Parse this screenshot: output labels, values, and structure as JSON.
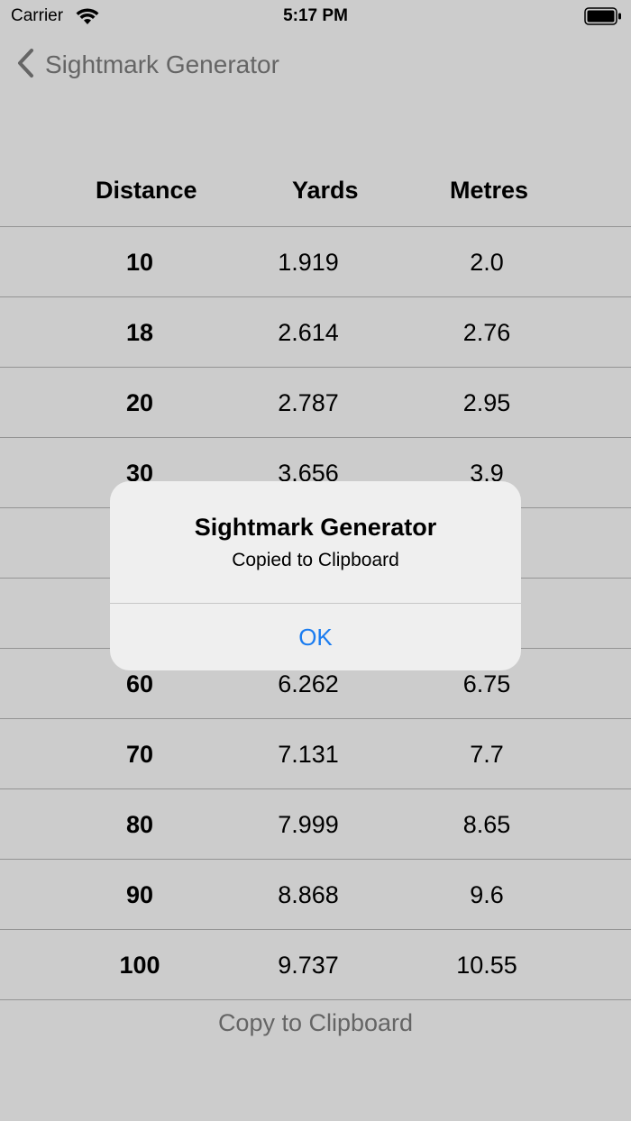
{
  "status_bar": {
    "carrier": "Carrier",
    "time": "5:17 PM",
    "wifi_icon": "wifi-icon",
    "battery_icon": "battery-icon"
  },
  "nav": {
    "back_label": "Sightmark Generator",
    "back_icon": "chevron-left-icon"
  },
  "table": {
    "headers": [
      "Distance",
      "Yards",
      "Metres"
    ],
    "rows": [
      {
        "distance": "10",
        "yards": "1.919",
        "metres": "2.0"
      },
      {
        "distance": "18",
        "yards": "2.614",
        "metres": "2.76"
      },
      {
        "distance": "20",
        "yards": "2.787",
        "metres": "2.95"
      },
      {
        "distance": "30",
        "yards": "3.656",
        "metres": "3.9"
      },
      {
        "distance": "",
        "yards": "",
        "metres": ""
      },
      {
        "distance": "",
        "yards": "",
        "metres": ""
      },
      {
        "distance": "60",
        "yards": "6.262",
        "metres": "6.75"
      },
      {
        "distance": "70",
        "yards": "7.131",
        "metres": "7.7"
      },
      {
        "distance": "80",
        "yards": "7.999",
        "metres": "8.65"
      },
      {
        "distance": "90",
        "yards": "8.868",
        "metres": "9.6"
      },
      {
        "distance": "100",
        "yards": "9.737",
        "metres": "10.55"
      }
    ]
  },
  "copy_button_label": "Copy to Clipboard",
  "alert": {
    "title": "Sightmark Generator",
    "message": "Copied to Clipboard",
    "ok_label": "OK"
  },
  "colors": {
    "accent": "#1a7cf0",
    "dim_text": "#7f7f7f",
    "divider": "#b9b9b9"
  }
}
